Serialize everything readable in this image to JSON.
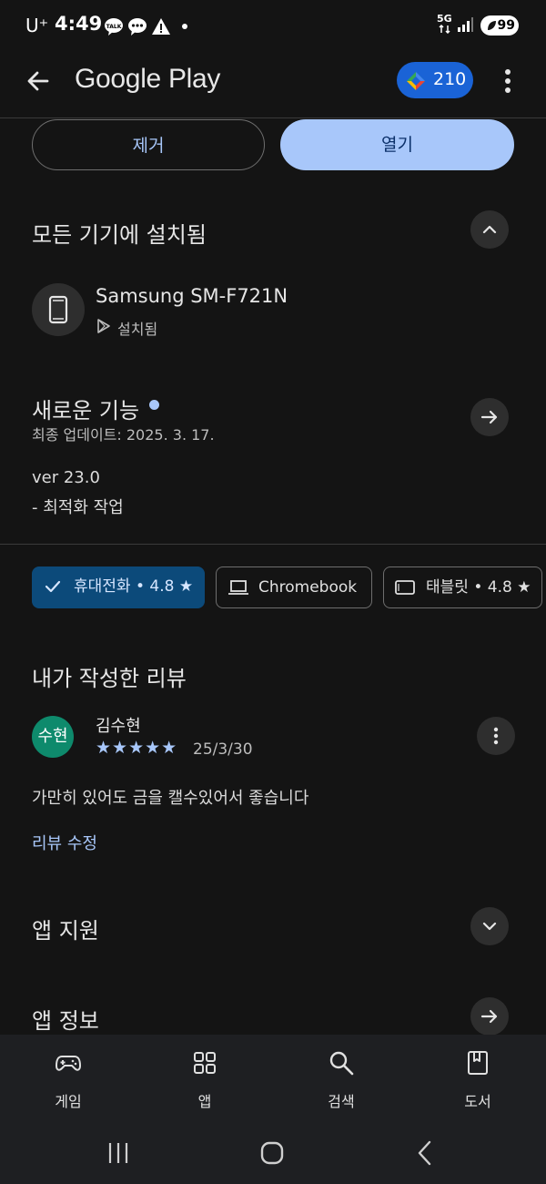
{
  "status": {
    "carrier": "U⁺",
    "time": "4:49",
    "network": "5G",
    "battery": "99"
  },
  "appbar": {
    "title": "Google Play",
    "points": "210",
    "icons": [
      "back-arrow-icon",
      "play-points-icon",
      "more-vert-icon"
    ]
  },
  "actions": {
    "remove_label": "제거",
    "open_label": "열기"
  },
  "installed": {
    "title": "모든 기기에 설치됨",
    "device_name": "Samsung SM-F721N",
    "device_status": "설치됨"
  },
  "whats_new": {
    "title": "새로운 기능",
    "updated": "최종 업데이트: 2025. 3. 17.",
    "version": "ver 23.0",
    "notes": "- 최적화 작업"
  },
  "device_chips": [
    {
      "label": "휴대전화 • 4.8 ★",
      "selected": true
    },
    {
      "label": "Chromebook",
      "selected": false
    },
    {
      "label": "태블릿 • 4.8 ★",
      "selected": false
    }
  ],
  "my_review": {
    "title": "내가 작성한 리뷰",
    "avatar_text": "수현",
    "author": "김수현",
    "stars": "★★★★★",
    "rating": 5,
    "date": "25/3/30",
    "text": "가만히 있어도 금을 캘수있어서 좋습니다",
    "edit_label": "리뷰 수정"
  },
  "sections": {
    "app_support": "앱 지원",
    "app_info": "앱 정보"
  },
  "bottom_nav": [
    {
      "label": "게임",
      "icon": "gamepad-icon"
    },
    {
      "label": "앱",
      "icon": "apps-grid-icon"
    },
    {
      "label": "검색",
      "icon": "search-icon"
    },
    {
      "label": "도서",
      "icon": "book-icon"
    }
  ],
  "colors": {
    "accent": "#a8c7fa",
    "points_badge": "#1a63d6",
    "selected_chip": "#0c4a7a",
    "avatar": "#0e8a6c"
  }
}
